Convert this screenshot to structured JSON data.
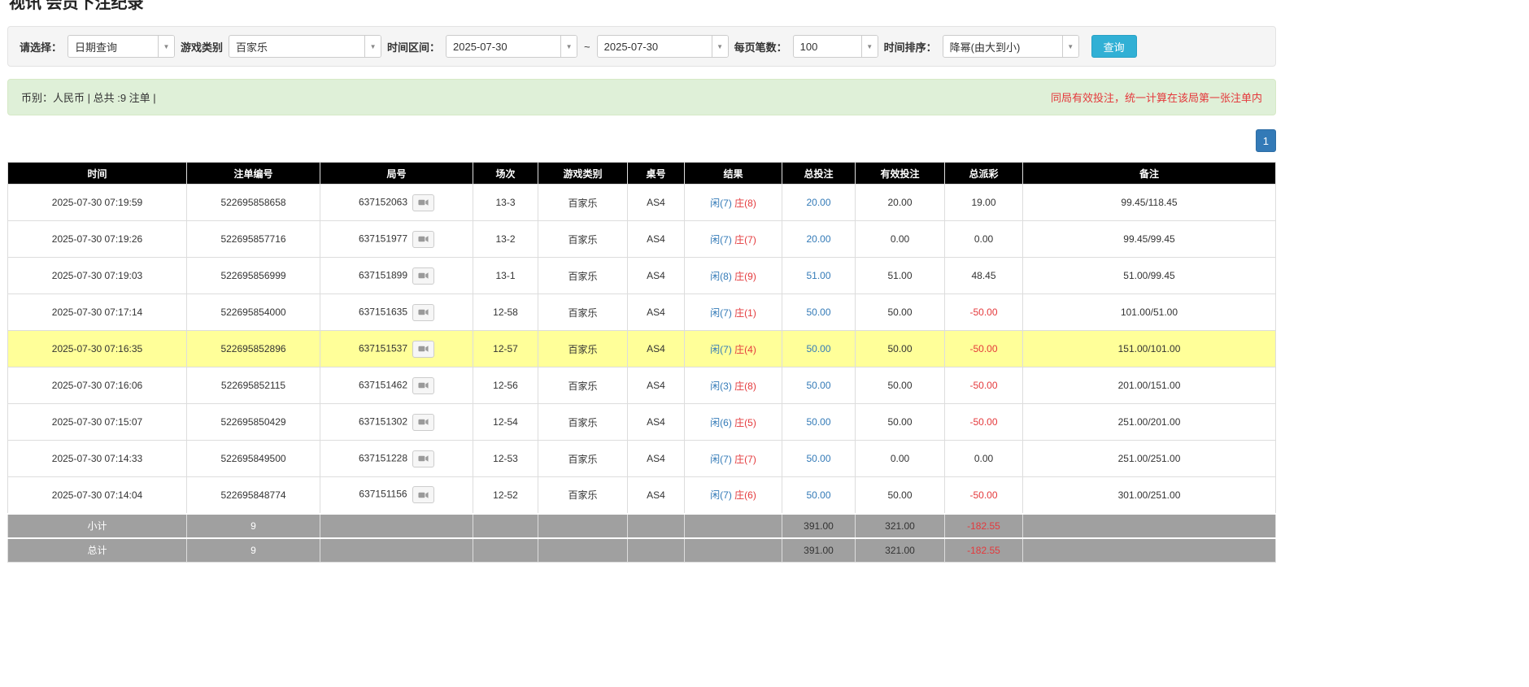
{
  "page": {
    "title": "视讯 会员下注纪录"
  },
  "filters": {
    "select_label": "请选择：",
    "select_value": "日期查询",
    "game_label": "游戏类别",
    "game_value": "百家乐",
    "range_label": "时间区间：",
    "date_from": "2025-07-30",
    "range_separator": "~",
    "date_to": "2025-07-30",
    "per_page_label": "每页笔数：",
    "per_page_value": "100",
    "sort_label": "时间排序：",
    "sort_value": "降幂(由大到小)",
    "query_button_label": "查询"
  },
  "alert": {
    "left_text": "币别：人民币 | 总共 :9 注单 |",
    "right_text": "同局有效投注，统一计算在该局第一张注单内"
  },
  "pagination": {
    "current_page": "1"
  },
  "colors": {
    "accent_blue": "#337ab7",
    "negative_red": "#e4393c",
    "query_button": "#31b0d5",
    "highlight_row": "#ffff99"
  },
  "table": {
    "headers": [
      "时间",
      "注单编号",
      "局号",
      "场次",
      "游戏类别",
      "桌号",
      "结果",
      "总投注",
      "有效投注",
      "总派彩",
      "备注"
    ],
    "rows": [
      {
        "time": "2025-07-30 07:19:59",
        "bet_id": "522695858658",
        "round_id": "637152063",
        "session": "13-3",
        "game": "百家乐",
        "table_no": "AS4",
        "player": "闲(7)",
        "banker": "庄(8)",
        "total_bet": "20.00",
        "valid_bet": "20.00",
        "payout": "19.00",
        "remark": "99.45/118.45",
        "highlighted": false
      },
      {
        "time": "2025-07-30 07:19:26",
        "bet_id": "522695857716",
        "round_id": "637151977",
        "session": "13-2",
        "game": "百家乐",
        "table_no": "AS4",
        "player": "闲(7)",
        "banker": "庄(7)",
        "total_bet": "20.00",
        "valid_bet": "0.00",
        "payout": "0.00",
        "remark": "99.45/99.45",
        "highlighted": false
      },
      {
        "time": "2025-07-30 07:19:03",
        "bet_id": "522695856999",
        "round_id": "637151899",
        "session": "13-1",
        "game": "百家乐",
        "table_no": "AS4",
        "player": "闲(8)",
        "banker": "庄(9)",
        "total_bet": "51.00",
        "valid_bet": "51.00",
        "payout": "48.45",
        "remark": "51.00/99.45",
        "highlighted": false
      },
      {
        "time": "2025-07-30 07:17:14",
        "bet_id": "522695854000",
        "round_id": "637151635",
        "session": "12-58",
        "game": "百家乐",
        "table_no": "AS4",
        "player": "闲(7)",
        "banker": "庄(1)",
        "total_bet": "50.00",
        "valid_bet": "50.00",
        "payout": "-50.00",
        "remark": "101.00/51.00",
        "highlighted": false
      },
      {
        "time": "2025-07-30 07:16:35",
        "bet_id": "522695852896",
        "round_id": "637151537",
        "session": "12-57",
        "game": "百家乐",
        "table_no": "AS4",
        "player": "闲(7)",
        "banker": "庄(4)",
        "total_bet": "50.00",
        "valid_bet": "50.00",
        "payout": "-50.00",
        "remark": "151.00/101.00",
        "highlighted": true
      },
      {
        "time": "2025-07-30 07:16:06",
        "bet_id": "522695852115",
        "round_id": "637151462",
        "session": "12-56",
        "game": "百家乐",
        "table_no": "AS4",
        "player": "闲(3)",
        "banker": "庄(8)",
        "total_bet": "50.00",
        "valid_bet": "50.00",
        "payout": "-50.00",
        "remark": "201.00/151.00",
        "highlighted": false
      },
      {
        "time": "2025-07-30 07:15:07",
        "bet_id": "522695850429",
        "round_id": "637151302",
        "session": "12-54",
        "game": "百家乐",
        "table_no": "AS4",
        "player": "闲(6)",
        "banker": "庄(5)",
        "total_bet": "50.00",
        "valid_bet": "50.00",
        "payout": "-50.00",
        "remark": "251.00/201.00",
        "highlighted": false
      },
      {
        "time": "2025-07-30 07:14:33",
        "bet_id": "522695849500",
        "round_id": "637151228",
        "session": "12-53",
        "game": "百家乐",
        "table_no": "AS4",
        "player": "闲(7)",
        "banker": "庄(7)",
        "total_bet": "50.00",
        "valid_bet": "0.00",
        "payout": "0.00",
        "remark": "251.00/251.00",
        "highlighted": false
      },
      {
        "time": "2025-07-30 07:14:04",
        "bet_id": "522695848774",
        "round_id": "637151156",
        "session": "12-52",
        "game": "百家乐",
        "table_no": "AS4",
        "player": "闲(7)",
        "banker": "庄(6)",
        "total_bet": "50.00",
        "valid_bet": "50.00",
        "payout": "-50.00",
        "remark": "301.00/251.00",
        "highlighted": false
      }
    ],
    "subtotal": {
      "label": "小计",
      "count": "9",
      "total_bet": "391.00",
      "valid_bet": "321.00",
      "payout": "-182.55"
    },
    "total": {
      "label": "总计",
      "count": "9",
      "total_bet": "391.00",
      "valid_bet": "321.00",
      "payout": "-182.55"
    }
  }
}
